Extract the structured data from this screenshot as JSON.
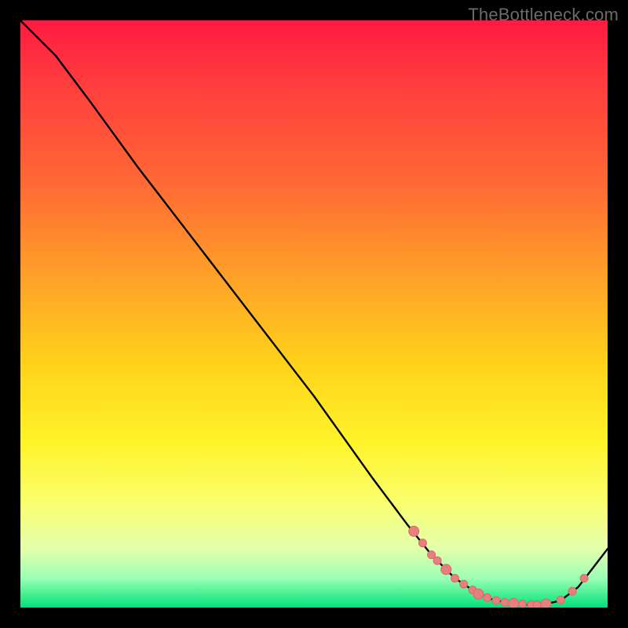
{
  "watermark": "TheBottleneck.com",
  "colors": {
    "bg": "#000000",
    "curve_stroke": "#000000",
    "marker_fill": "#e77f7d",
    "marker_stroke": "#d76a68"
  },
  "chart_data": {
    "type": "line",
    "title": "",
    "xlabel": "",
    "ylabel": "",
    "xlim": [
      0,
      100
    ],
    "ylim": [
      0,
      100
    ],
    "series": [
      {
        "name": "curve",
        "x": [
          0,
          6,
          12,
          20,
          30,
          40,
          50,
          60,
          66,
          70,
          74,
          77,
          80,
          83,
          86,
          89,
          92,
          95,
          100
        ],
        "y": [
          100,
          94,
          86,
          75,
          62,
          49,
          36,
          22,
          14,
          9,
          5,
          3,
          1.5,
          0.8,
          0.5,
          0.5,
          1.2,
          3.5,
          10
        ]
      }
    ],
    "markers": {
      "note": "dots highlighting the trough region",
      "x": [
        67,
        68.5,
        70,
        71,
        72.5,
        74,
        75.5,
        77,
        78,
        79.5,
        81,
        82.5,
        84,
        85.5,
        87,
        88,
        89.5,
        92,
        94,
        96
      ],
      "y": [
        13,
        11,
        9,
        8,
        6.5,
        5,
        4,
        3,
        2.3,
        1.7,
        1.2,
        0.9,
        0.7,
        0.6,
        0.5,
        0.5,
        0.6,
        1.3,
        2.8,
        5
      ]
    }
  }
}
